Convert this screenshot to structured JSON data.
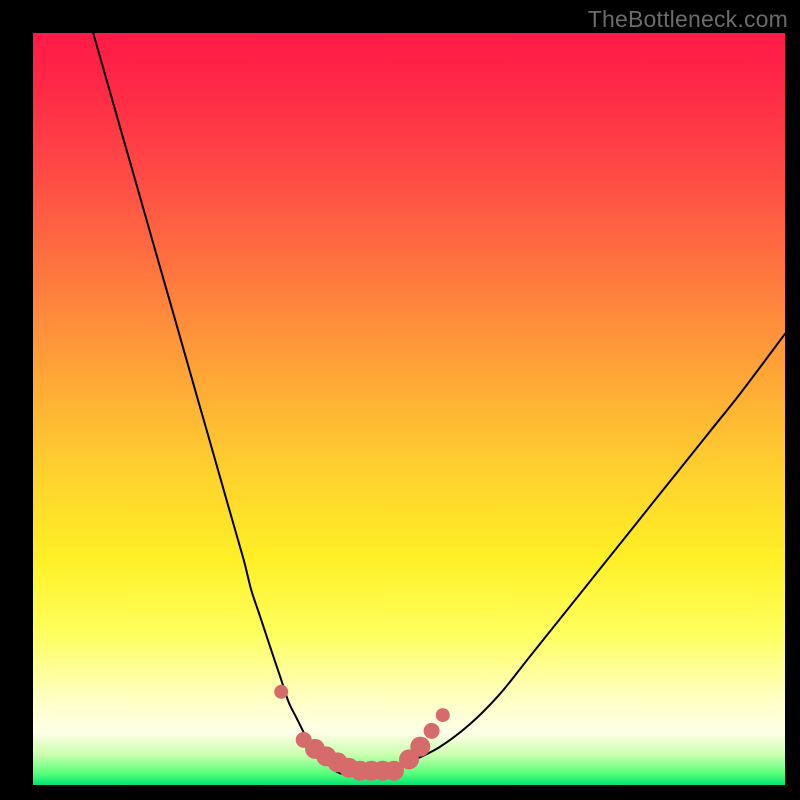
{
  "watermark": "TheBottleneck.com",
  "chart_data": {
    "type": "line",
    "title": "",
    "xlabel": "",
    "ylabel": "",
    "xlim": [
      0,
      100
    ],
    "ylim": [
      0,
      100
    ],
    "series": [
      {
        "name": "bottleneck-curve",
        "x": [
          8,
          10,
          12,
          14,
          16,
          18,
          20,
          22,
          24,
          26,
          28,
          29,
          30,
          31,
          32,
          33,
          34,
          35,
          36,
          37,
          38,
          39,
          40,
          41,
          42,
          44,
          46,
          48,
          50,
          54,
          58,
          62,
          66,
          70,
          74,
          78,
          82,
          86,
          90,
          94,
          100
        ],
        "values": [
          100,
          93,
          86,
          79,
          72,
          65,
          58,
          51,
          44,
          37,
          30,
          26,
          23,
          20,
          17,
          14,
          11,
          9,
          7,
          5,
          4,
          3,
          2,
          1.5,
          1.5,
          1.5,
          1.5,
          2,
          3,
          5,
          8,
          12,
          17,
          22,
          27,
          32,
          37,
          42,
          47,
          52,
          60
        ]
      }
    ],
    "markers": {
      "name": "highlight-dots",
      "x": [
        33.0,
        36.0,
        37.5,
        39.0,
        40.5,
        42.0,
        43.5,
        45.0,
        46.5,
        48.0,
        50.0,
        51.5,
        53.0,
        54.5
      ],
      "values": [
        12.4,
        6.0,
        4.8,
        3.8,
        3.0,
        2.3,
        1.9,
        1.9,
        1.9,
        1.9,
        3.4,
        5.1,
        7.2,
        9.3
      ],
      "sizes": [
        7,
        8,
        10,
        10,
        10,
        10,
        10,
        10,
        10,
        10,
        10,
        10,
        8,
        7
      ]
    },
    "background_gradient": {
      "direction": "vertical",
      "stops": [
        {
          "pos": 0.0,
          "color": "#ff1a47"
        },
        {
          "pos": 0.33,
          "color": "#ff7a3e"
        },
        {
          "pos": 0.7,
          "color": "#fff026"
        },
        {
          "pos": 0.93,
          "color": "#ffffe8"
        },
        {
          "pos": 1.0,
          "color": "#00e472"
        }
      ]
    }
  }
}
